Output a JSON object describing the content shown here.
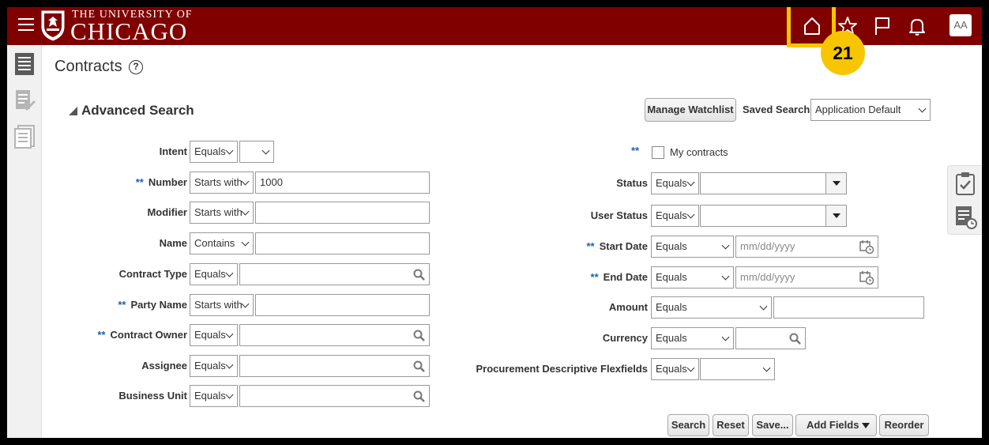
{
  "header": {
    "university_top": "THE UNIVERSITY OF",
    "university_main": "CHICAGO",
    "avatar_initials": "AA",
    "step_badge": "21",
    "icons": [
      "menu-icon",
      "home-icon",
      "star-icon",
      "flag-icon",
      "bell-icon"
    ],
    "brand_color": "#800000",
    "highlight_color": "#f7c600"
  },
  "page": {
    "title": "Contracts",
    "help": "?"
  },
  "search": {
    "section_title": "Advanced Search",
    "manage_watchlist": "Manage Watchlist",
    "saved_search_label": "Saved Search",
    "saved_search_value": "Application Default",
    "required_mark": "**",
    "left_fields": [
      {
        "label": "Intent",
        "operator": "Equals",
        "value": ""
      },
      {
        "label": "Number",
        "operator": "Starts with",
        "value": "1000"
      },
      {
        "label": "Modifier",
        "operator": "Starts with",
        "value": ""
      },
      {
        "label": "Name",
        "operator": "Contains",
        "value": ""
      },
      {
        "label": "Contract Type",
        "operator": "Equals",
        "value": ""
      },
      {
        "label": "Party Name",
        "operator": "Starts with",
        "value": ""
      },
      {
        "label": "Contract Owner",
        "operator": "Equals",
        "value": ""
      },
      {
        "label": "Assignee",
        "operator": "Equals",
        "value": ""
      },
      {
        "label": "Business Unit",
        "operator": "Equals",
        "value": ""
      }
    ],
    "my_contracts_label": "My contracts",
    "right_fields": [
      {
        "label": "Status",
        "operator": "Equals",
        "value": ""
      },
      {
        "label": "User Status",
        "operator": "Equals",
        "value": ""
      },
      {
        "label": "Start Date",
        "operator": "Equals",
        "placeholder": "mm/dd/yyyy"
      },
      {
        "label": "End Date",
        "operator": "Equals",
        "placeholder": "mm/dd/yyyy"
      },
      {
        "label": "Amount",
        "operator": "Equals",
        "value": ""
      },
      {
        "label": "Currency",
        "operator": "Equals",
        "value": ""
      },
      {
        "label": "Procurement Descriptive Flexfields",
        "operator": "Equals",
        "value": ""
      }
    ],
    "buttons": {
      "search": "Search",
      "reset": "Reset",
      "save": "Save...",
      "add_fields": "Add Fields",
      "reorder": "Reorder"
    }
  }
}
